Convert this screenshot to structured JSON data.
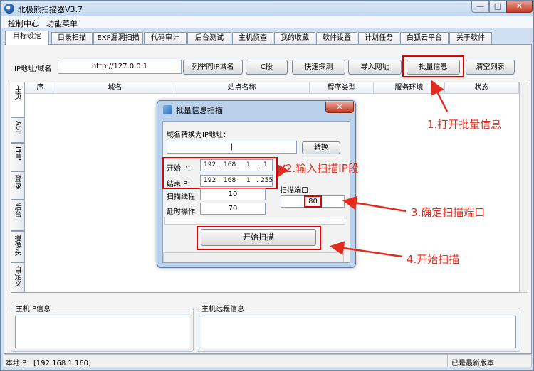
{
  "window": {
    "title": "北极熊扫描器V3.7",
    "minimize": "—",
    "maximize": "□",
    "close": "✕"
  },
  "menu": [
    "控制中心",
    "功能菜单"
  ],
  "tabs": [
    "目标设定",
    "目录扫描",
    "EXP漏洞扫描",
    "代码审计",
    "后台测试",
    "主机侦查",
    "我的收藏",
    "软件设置",
    "计划任务",
    "白狐云平台",
    "关于软件"
  ],
  "toolbar": {
    "ip_label": "IP地址/域名",
    "ip_value": "http://127.0.0.1",
    "buttons": [
      "列举同IP域名",
      "C段",
      "快速探测",
      "导入网址",
      "批量信息",
      "清空列表"
    ]
  },
  "table": {
    "columns": [
      "序",
      "域名",
      "站点名称",
      "程序类型",
      "服务环境",
      "状态"
    ]
  },
  "side_tabs": [
    "主页",
    "ASP",
    "PHP",
    "登录",
    "后台",
    "摄像头",
    "自定义"
  ],
  "bottom": {
    "host_ip_info": "主机IP信息",
    "host_remote_info": "主机远程信息"
  },
  "status": {
    "local_ip": "本地IP：[192.168.1.160]",
    "version": "已是最新版本"
  },
  "dialog": {
    "title": "批量信息扫描",
    "close": "✕",
    "domain_label": "域名转换为IP地址：",
    "domain_value": "|",
    "convert_button": "转换",
    "start_ip_label": "开始IP：",
    "start_ip": [
      "192",
      "168",
      "1",
      "1"
    ],
    "end_ip_label": "结束IP：",
    "end_ip": [
      "192",
      "168",
      "1",
      "255"
    ],
    "threads_label": "扫描线程",
    "threads_value": "10",
    "delay_label": "延时操作",
    "delay_value": "70",
    "port_label": "扫描端口：",
    "port_value": "80",
    "start_button": "开始扫描"
  },
  "annotations": [
    "1.打开批量信息",
    "2.输入扫描IP段",
    "3.确定扫描端口",
    "4.开始扫描"
  ],
  "colors": {
    "annotation": "#e42a1c",
    "highlight_box": "#e10000"
  }
}
